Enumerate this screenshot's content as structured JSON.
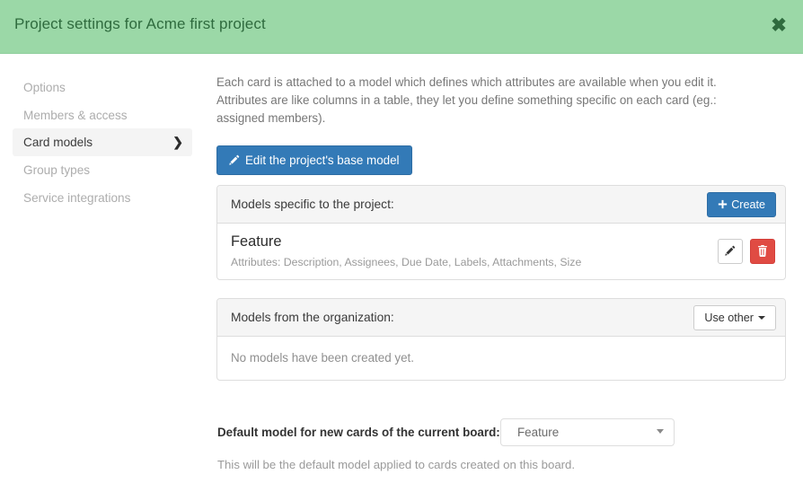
{
  "header": {
    "title": "Project settings for Acme first project",
    "close_label": "✖",
    "bg_color": "#9bd8a7",
    "text_color": "#2f6b3e"
  },
  "sidebar": {
    "items": [
      {
        "label": "Options",
        "active": false
      },
      {
        "label": "Members & access",
        "active": false
      },
      {
        "label": "Card models",
        "active": true,
        "chevron": "❯"
      },
      {
        "label": "Group types",
        "active": false
      },
      {
        "label": "Service integrations",
        "active": false
      }
    ]
  },
  "main": {
    "intro": "Each card is attached to a model which defines which attributes are available when you edit it. Attributes are like columns in a table, they let you define something specific on each card (eg.: assigned members).",
    "edit_base_model_label": "Edit the project's base model",
    "project_models_panel": {
      "title": "Models specific to the project:",
      "create_label": "Create",
      "rows": [
        {
          "name": "Feature",
          "attributes": "Attributes: Description, Assignees, Due Date, Labels, Attachments, Size"
        }
      ]
    },
    "org_models_panel": {
      "title": "Models from the organization:",
      "use_other_label": "Use other",
      "empty_message": "No models have been created yet."
    },
    "default_model": {
      "label": "Default model for new cards of the current board:",
      "selected": "Feature",
      "options": [
        "Feature"
      ],
      "help": "This will be the default model applied to cards created on this board."
    }
  },
  "colors": {
    "primary": "#337ab7",
    "danger": "#e04b43",
    "panel_header_bg": "#f5f5f5",
    "border": "#dddddd",
    "muted_text": "#9a9a9a"
  }
}
